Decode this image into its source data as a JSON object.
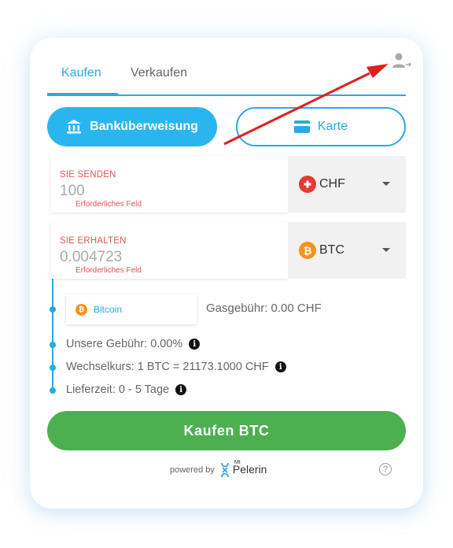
{
  "tabs": {
    "buy": "Kaufen",
    "sell": "Verkaufen"
  },
  "payment_methods": {
    "bank": "Banküberweisung",
    "card": "Karte"
  },
  "send": {
    "label": "SIE SENDEN",
    "placeholder": "100",
    "error": "Erforderliches Feld",
    "currency": "CHF"
  },
  "receive": {
    "label": "SIE ERHALTEN",
    "placeholder": "0.004723",
    "error": "Erforderliches Feld",
    "currency": "BTC"
  },
  "network": {
    "chip": "Bitcoin",
    "gas_fee": "Gasgebühr: 0.00 CHF"
  },
  "details": {
    "fee": "Unsere Gebühr: 0.00%",
    "rate": "Wechselkurs: 1 BTC = 21173.1000 CHF",
    "delivery": "Lieferzeit: 0 - 5 Tage"
  },
  "buy_button": "Kaufen BTC",
  "footer": {
    "powered_by": "powered by",
    "brand_mt": "Mt",
    "brand_name": "Pelerin",
    "help": "?"
  },
  "colors": {
    "accent": "#29aae2",
    "buy": "#4caf50",
    "error": "#e05555",
    "btc": "#f7931a",
    "chf": "#e53935",
    "annotation": "#e02020"
  },
  "icons": [
    "user-transfer-icon",
    "bank-icon",
    "card-icon",
    "swiss-flag-icon",
    "bitcoin-icon",
    "info-icon",
    "help-icon",
    "mt-pelerin-logo"
  ]
}
